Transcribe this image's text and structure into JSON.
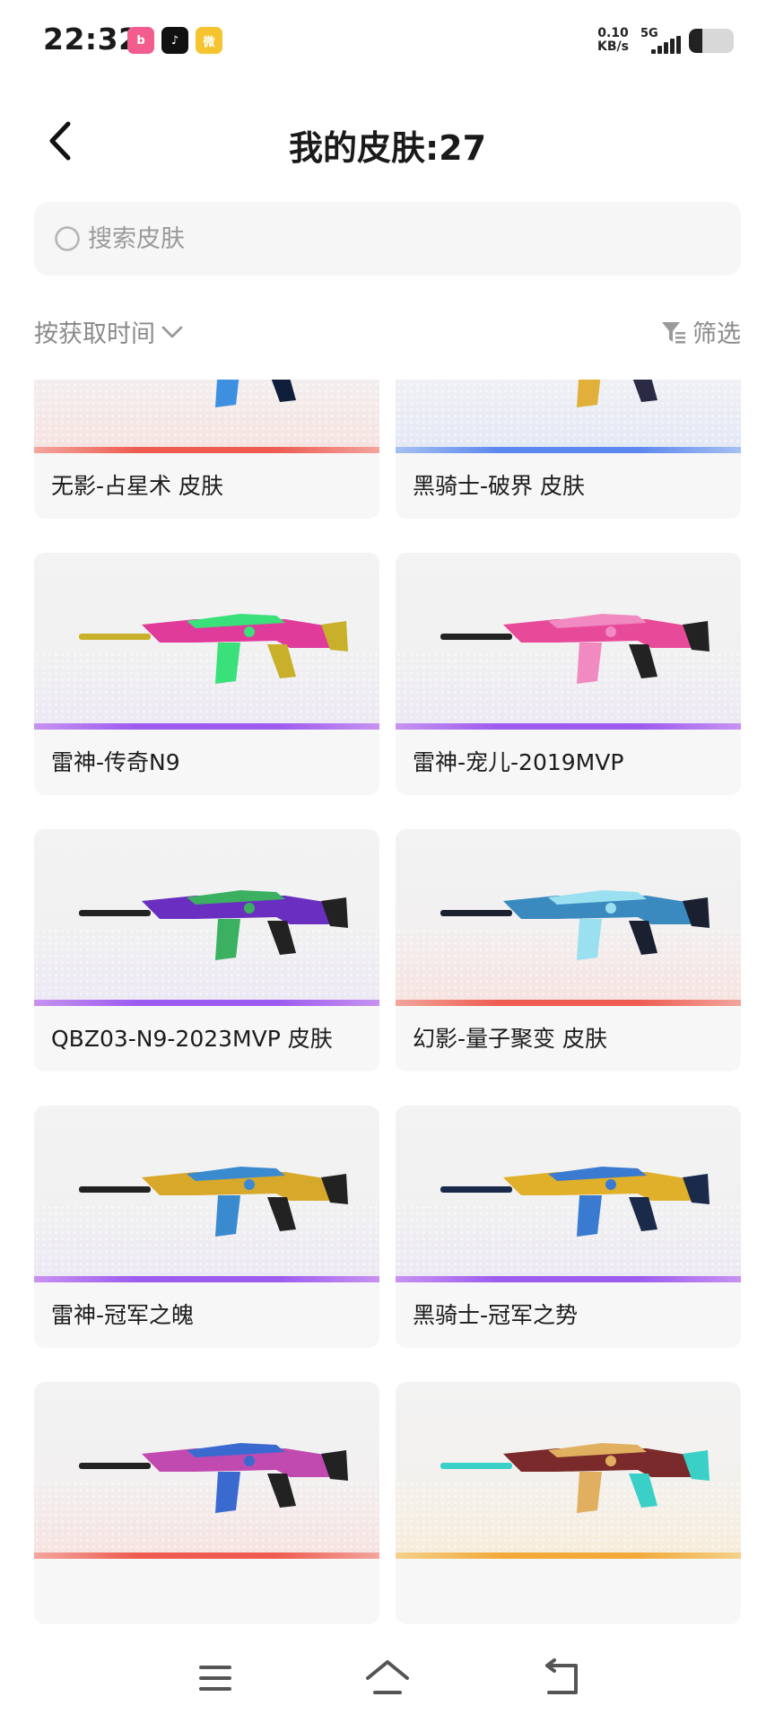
{
  "status_bar": {
    "time": "22:32",
    "apps": [
      {
        "icon": "bilibili-icon",
        "glyph": "b"
      },
      {
        "icon": "tiktok-icon",
        "glyph": "♪"
      },
      {
        "icon": "weibo-icon",
        "glyph": "微"
      }
    ],
    "speed_value": "0.10",
    "speed_unit": "KB/s",
    "network": "5G",
    "battery_level": 0.3
  },
  "header": {
    "back_icon": "chevron-left-icon",
    "title": "我的皮肤:27"
  },
  "search": {
    "placeholder": "搜索皮肤",
    "value": ""
  },
  "toolbar": {
    "sort_label": "按获取时间",
    "filter_label": "筛选"
  },
  "skins": [
    {
      "name": "无影-占星术 皮肤",
      "rarity": "red"
    },
    {
      "name": "黑骑士-破界 皮肤",
      "rarity": "blue"
    },
    {
      "name": "雷神-传奇N9",
      "rarity": "purple"
    },
    {
      "name": "雷神-宠儿-2019MVP",
      "rarity": "purple"
    },
    {
      "name": "QBZ03-N9-2023MVP 皮肤",
      "rarity": "purple"
    },
    {
      "name": "幻影-量子聚变 皮肤",
      "rarity": "red"
    },
    {
      "name": "雷神-冠军之魄",
      "rarity": "purple"
    },
    {
      "name": "黑骑士-冠军之势",
      "rarity": "purple"
    },
    {
      "name": "",
      "rarity": "red"
    },
    {
      "name": "",
      "rarity": "gold"
    }
  ],
  "colors": {
    "purple": "#9b5af0",
    "red": "#ee5b50",
    "blue": "#5b87ee",
    "gold": "#f2a93a"
  },
  "nav": {
    "menu_icon": "menu-icon",
    "home_icon": "home-icon",
    "back_icon": "back-icon"
  }
}
